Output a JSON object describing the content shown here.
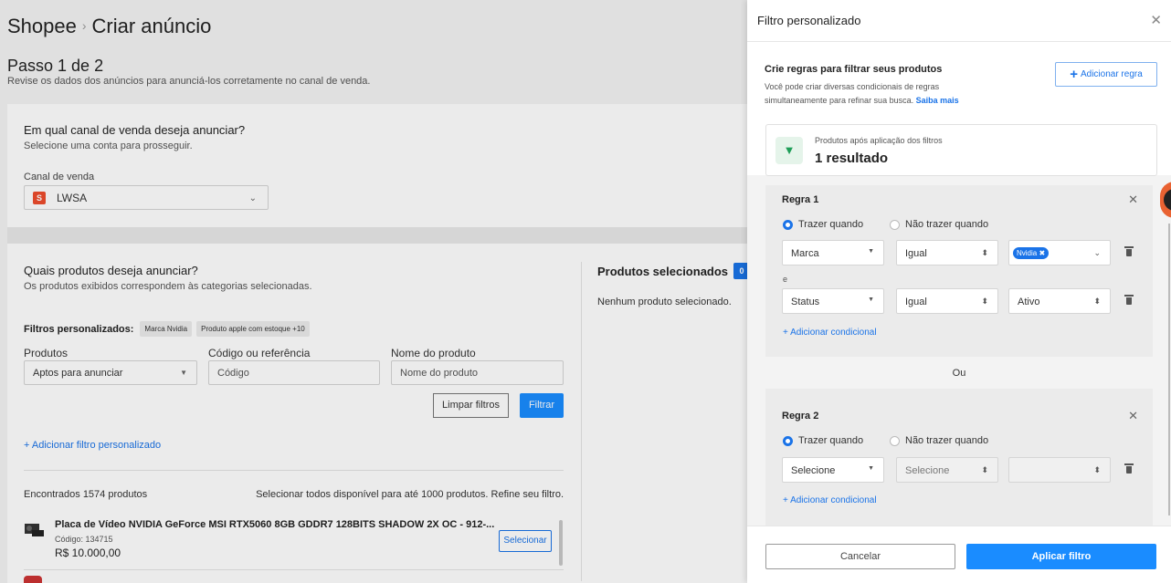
{
  "breadcrumb": {
    "root": "Shopee",
    "separator": "›",
    "current": "Criar anúncio"
  },
  "step": {
    "title": "Passo 1 de 2",
    "subtitle": "Revise os dados dos anúncios para anunciá-los corretamente no canal de venda."
  },
  "channel": {
    "question": "Em qual canal de venda deseja anunciar?",
    "hint": "Selecione uma conta para prosseguir.",
    "label": "Canal de venda",
    "value": "LWSA"
  },
  "products": {
    "question": "Quais produtos deseja anunciar?",
    "hint": "Os produtos exibidos correspondem às categorias selecionadas.",
    "custom_filters_label": "Filtros personalizados:",
    "chips": [
      "Marca Nvidia",
      "Produto apple com estoque +10"
    ],
    "fields": [
      {
        "label": "Produtos",
        "value": "Aptos para anunciar"
      },
      {
        "label": "Código ou referência",
        "placeholder": "Código"
      },
      {
        "label": "Nome do produto",
        "placeholder": "Nome do produto"
      }
    ],
    "clear_label": "Limpar filtros",
    "filter_label": "Filtrar",
    "add_custom_filter": "+ Adicionar filtro personalizado",
    "found": "Encontrados 1574 produtos",
    "select_all": "Selecionar todos disponível para até 1000 produtos. Refine seu filtro.",
    "items": [
      {
        "name": "Placa de Vídeo NVIDIA GeForce MSI RTX5060 8GB GDDR7 128BITS SHADOW 2X OC - 912-...",
        "code": "Código: 134715",
        "price": "R$ 10.000,00",
        "select_label": "Selecionar"
      }
    ],
    "selected_title": "Produtos selecionados",
    "selected_count": "0",
    "none_selected": "Nenhum produto selecionado."
  },
  "drawer": {
    "title": "Filtro personalizado",
    "close_icon": "close-icon",
    "intro_title": "Crie regras para filtrar seus produtos",
    "intro_desc": "Você pode criar diversas condicionais de regras simultaneamente para refinar sua busca.",
    "intro_link": "Saiba mais",
    "add_rule_label": "Adicionar regra",
    "result_label": "Produtos após aplicação dos filtros",
    "result_value": "1 resultado",
    "rules": [
      {
        "title": "Regra 1",
        "option_include": "Trazer quando",
        "option_exclude": "Não trazer quando",
        "conditions": [
          {
            "field": "Marca",
            "operator": "Igual",
            "value_tag": "Nvidia"
          },
          {
            "connector": "e",
            "field": "Status",
            "operator": "Igual",
            "value": "Ativo"
          }
        ],
        "add_condition": "+ Adicionar condicional"
      },
      {
        "title": "Regra 2",
        "option_include": "Trazer quando",
        "option_exclude": "Não trazer quando",
        "conditions": [
          {
            "field": "Selecione",
            "operator": "Selecione",
            "value": ""
          }
        ],
        "add_condition": "+ Adicionar condicional"
      }
    ],
    "or_label": "Ou",
    "cancel_label": "Cancelar",
    "apply_label": "Aplicar filtro"
  },
  "colors": {
    "primary": "#1a8cff",
    "link": "#1a73e8",
    "shopee": "#ee4d2d",
    "success": "#1e9e57"
  }
}
